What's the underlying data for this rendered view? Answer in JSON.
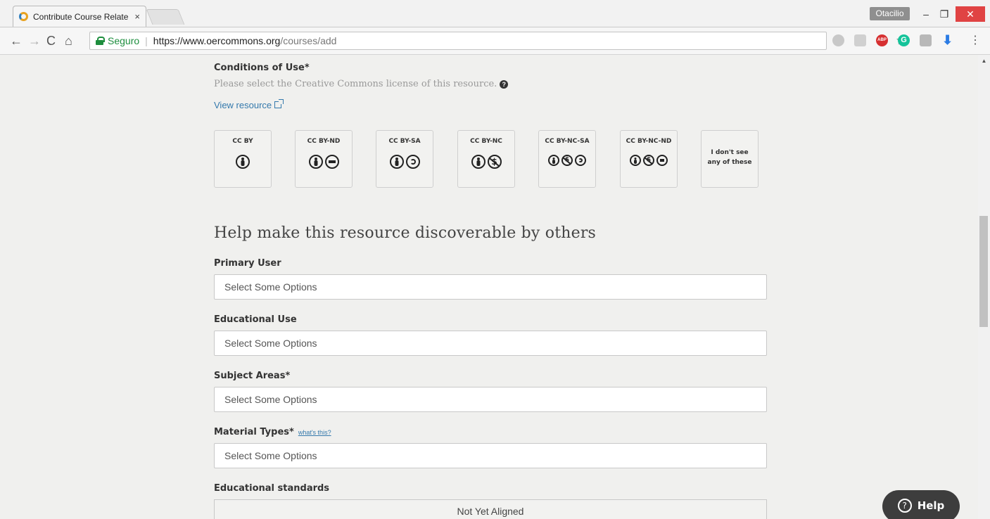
{
  "browser": {
    "tab_title": "Contribute Course Relate",
    "tab_close": "×",
    "profile_name": "Otacilio",
    "min_glyph": "–",
    "max_glyph": "❐",
    "close_glyph": "✕",
    "back_glyph": "←",
    "forward_glyph": "→",
    "reload_glyph": "C",
    "home_glyph": "⌂",
    "secure_label": "Seguro",
    "url_host": "https://www.oercommons.org",
    "url_path": "/courses/add",
    "star_glyph": "☆",
    "extensions": {
      "abp": "ABP",
      "grammarly": "G",
      "download": "⬇"
    },
    "menu_glyph": "⋮",
    "icons": [
      "back-icon",
      "forward-icon",
      "reload-icon",
      "home-icon",
      "lock-icon",
      "star-icon",
      "extension-icons",
      "menu-icon"
    ]
  },
  "form": {
    "conditions_label": "Conditions of Use*",
    "conditions_help": "Please select the Creative Commons license of this resource.",
    "help_glyph": "?",
    "view_resource": "View resource",
    "licenses": [
      {
        "name": "CC BY"
      },
      {
        "name": "CC BY-ND"
      },
      {
        "name": "CC BY-SA"
      },
      {
        "name": "CC BY-NC"
      },
      {
        "name": "CC BY-NC-SA"
      },
      {
        "name": "CC BY-NC-ND"
      },
      {
        "name": "I don't see any of these"
      }
    ],
    "section_heading": "Help make this resource discoverable by others",
    "primary_user": {
      "label": "Primary User",
      "placeholder": "Select Some Options"
    },
    "educational_use": {
      "label": "Educational Use",
      "placeholder": "Select Some Options"
    },
    "subject_areas": {
      "label": "Subject Areas*",
      "placeholder": "Select Some Options"
    },
    "material_types": {
      "label": "Material Types*",
      "whats_this": "what's this?",
      "placeholder": "Select Some Options"
    },
    "educational_standards": {
      "label": "Educational standards",
      "value": "Not Yet Aligned"
    }
  },
  "help_widget": {
    "label": "Help",
    "glyph": "?"
  },
  "colors": {
    "accent_link": "#3479ac",
    "secure_green": "#1e8e3e",
    "close_red": "#e04343",
    "page_bg": "#f0f0ee"
  }
}
